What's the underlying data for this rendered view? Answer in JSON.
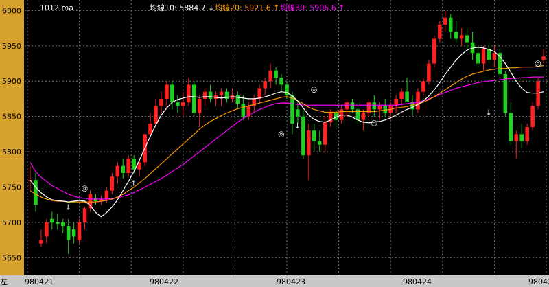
{
  "chart_data": {
    "type": "candlestick",
    "title": "1012.ma",
    "legend": [
      {
        "label": "均線10: 5884.7",
        "arrow": "↓",
        "color": "#ffffff"
      },
      {
        "label": "均線20: 5921.6",
        "arrow": "↑",
        "color": "#ff9900"
      },
      {
        "label": "均線30: 5906.6",
        "arrow": "↑",
        "color": "#ff00ff"
      }
    ],
    "ylim": [
      5625,
      6015
    ],
    "yticks": [
      5650,
      5700,
      5750,
      5800,
      5850,
      5900,
      5950,
      6000
    ],
    "xtick_labels": [
      "980421",
      "980422",
      "980423",
      "980424",
      "98042"
    ],
    "left_axis_fragment": "左",
    "colors": {
      "up": "#ff2020",
      "down": "#20d020",
      "ma10": "#ffffff",
      "ma20": "#ff9900",
      "ma30": "#ff00ff",
      "grid": "#7a7a7a",
      "axis_bg": "#d6a12c"
    },
    "candles": [
      [
        5760,
        5780,
        5745,
        5760
      ],
      [
        5760,
        5770,
        5715,
        5725
      ],
      [
        5670,
        5690,
        5665,
        5675
      ],
      [
        5680,
        5705,
        5670,
        5700
      ],
      [
        5705,
        5715,
        5690,
        5700
      ],
      [
        5700,
        5712,
        5690,
        5698
      ],
      [
        5700,
        5705,
        5685,
        5695
      ],
      [
        5695,
        5705,
        5655,
        5675
      ],
      [
        5690,
        5700,
        5670,
        5680
      ],
      [
        5675,
        5705,
        5670,
        5700
      ],
      [
        5700,
        5722,
        5690,
        5720
      ],
      [
        5720,
        5745,
        5715,
        5740
      ],
      [
        5735,
        5740,
        5725,
        5730
      ],
      [
        5730,
        5738,
        5725,
        5733
      ],
      [
        5733,
        5750,
        5728,
        5745
      ],
      [
        5745,
        5770,
        5740,
        5765
      ],
      [
        5765,
        5785,
        5755,
        5780
      ],
      [
        5780,
        5790,
        5762,
        5770
      ],
      [
        5770,
        5795,
        5765,
        5790
      ],
      [
        5790,
        5795,
        5770,
        5775
      ],
      [
        5775,
        5790,
        5765,
        5785
      ],
      [
        5785,
        5825,
        5780,
        5825
      ],
      [
        5825,
        5855,
        5820,
        5840
      ],
      [
        5840,
        5875,
        5835,
        5865
      ],
      [
        5865,
        5885,
        5855,
        5875
      ],
      [
        5875,
        5900,
        5860,
        5895
      ],
      [
        5895,
        5900,
        5860,
        5870
      ],
      [
        5870,
        5880,
        5855,
        5865
      ],
      [
        5865,
        5885,
        5850,
        5870
      ],
      [
        5870,
        5905,
        5865,
        5895
      ],
      [
        5895,
        5900,
        5850,
        5855
      ],
      [
        5855,
        5880,
        5835,
        5875
      ],
      [
        5875,
        5890,
        5865,
        5885
      ],
      [
        5885,
        5895,
        5870,
        5875
      ],
      [
        5875,
        5885,
        5865,
        5880
      ],
      [
        5880,
        5890,
        5865,
        5885
      ],
      [
        5885,
        5890,
        5870,
        5875
      ],
      [
        5875,
        5890,
        5870,
        5880
      ],
      [
        5880,
        5885,
        5860,
        5868
      ],
      [
        5868,
        5880,
        5845,
        5850
      ],
      [
        5850,
        5870,
        5845,
        5865
      ],
      [
        5865,
        5880,
        5855,
        5875
      ],
      [
        5875,
        5895,
        5870,
        5890
      ],
      [
        5890,
        5905,
        5880,
        5900
      ],
      [
        5900,
        5925,
        5890,
        5915
      ],
      [
        5915,
        5920,
        5895,
        5905
      ],
      [
        5905,
        5910,
        5885,
        5895
      ],
      [
        5895,
        5900,
        5875,
        5880
      ],
      [
        5880,
        5885,
        5825,
        5840
      ],
      [
        5860,
        5870,
        5840,
        5850
      ],
      [
        5850,
        5860,
        5790,
        5795
      ],
      [
        5795,
        5840,
        5760,
        5830
      ],
      [
        5830,
        5840,
        5800,
        5815
      ],
      [
        5815,
        5830,
        5800,
        5810
      ],
      [
        5810,
        5850,
        5800,
        5842
      ],
      [
        5842,
        5860,
        5835,
        5855
      ],
      [
        5855,
        5862,
        5835,
        5845
      ],
      [
        5845,
        5865,
        5840,
        5860
      ],
      [
        5860,
        5875,
        5850,
        5870
      ],
      [
        5870,
        5875,
        5855,
        5860
      ],
      [
        5860,
        5870,
        5840,
        5845
      ],
      [
        5845,
        5860,
        5830,
        5855
      ],
      [
        5855,
        5875,
        5850,
        5870
      ],
      [
        5870,
        5880,
        5850,
        5860
      ],
      [
        5860,
        5870,
        5845,
        5865
      ],
      [
        5865,
        5875,
        5850,
        5855
      ],
      [
        5855,
        5870,
        5845,
        5865
      ],
      [
        5865,
        5880,
        5855,
        5875
      ],
      [
        5875,
        5890,
        5865,
        5885
      ],
      [
        5885,
        5905,
        5870,
        5870
      ],
      [
        5870,
        5880,
        5850,
        5860
      ],
      [
        5860,
        5890,
        5855,
        5885
      ],
      [
        5885,
        5905,
        5880,
        5900
      ],
      [
        5900,
        5930,
        5895,
        5925
      ],
      [
        5925,
        5965,
        5920,
        5960
      ],
      [
        5960,
        5985,
        5955,
        5980
      ],
      [
        5980,
        6000,
        5970,
        5990
      ],
      [
        5990,
        5995,
        5960,
        5970
      ],
      [
        5970,
        5985,
        5955,
        5960
      ],
      [
        5960,
        5975,
        5950,
        5965
      ],
      [
        5965,
        5975,
        5945,
        5955
      ],
      [
        5955,
        5970,
        5930,
        5940
      ],
      [
        5940,
        5950,
        5920,
        5925
      ],
      [
        5925,
        5950,
        5915,
        5945
      ],
      [
        5945,
        5955,
        5925,
        5930
      ],
      [
        5930,
        5950,
        5920,
        5940
      ],
      [
        5940,
        5945,
        5905,
        5910
      ],
      [
        5910,
        5915,
        5850,
        5855
      ],
      [
        5855,
        5870,
        5810,
        5815
      ],
      [
        5815,
        5830,
        5790,
        5825
      ],
      [
        5825,
        5840,
        5805,
        5815
      ],
      [
        5815,
        5840,
        5810,
        5835
      ],
      [
        5835,
        5870,
        5830,
        5865
      ],
      [
        5865,
        5905,
        5860,
        5900
      ],
      [
        5930,
        5945,
        5925,
        5935
      ]
    ],
    "ma10": [
      5760,
      5750,
      5742,
      5736,
      5732,
      5731,
      5730,
      5729,
      5730,
      5731,
      5730,
      5724,
      5714,
      5708,
      5714,
      5722,
      5732,
      5745,
      5758,
      5772,
      5788,
      5805,
      5822,
      5838,
      5852,
      5862,
      5870,
      5874,
      5876,
      5878,
      5878,
      5877,
      5878,
      5878,
      5877,
      5876,
      5877,
      5878,
      5877,
      5876,
      5875,
      5875,
      5876,
      5878,
      5880,
      5883,
      5885,
      5884,
      5879,
      5872,
      5862,
      5852,
      5846,
      5843,
      5842,
      5845,
      5849,
      5852,
      5852,
      5849,
      5845,
      5842,
      5841,
      5842,
      5843,
      5845,
      5848,
      5852,
      5856,
      5860,
      5863,
      5867,
      5872,
      5879,
      5888,
      5898,
      5910,
      5920,
      5930,
      5938,
      5944,
      5947,
      5948,
      5947,
      5945,
      5942,
      5935,
      5925,
      5913,
      5900,
      5890,
      5884,
      5883,
      5883,
      5885
    ],
    "ma20": [
      5745,
      5740,
      5736,
      5733,
      5731,
      5730,
      5730,
      5729,
      5729,
      5729,
      5729,
      5729,
      5729,
      5730,
      5731,
      5733,
      5736,
      5740,
      5745,
      5750,
      5756,
      5762,
      5769,
      5776,
      5783,
      5790,
      5797,
      5804,
      5811,
      5818,
      5825,
      5832,
      5838,
      5843,
      5847,
      5851,
      5855,
      5858,
      5861,
      5863,
      5865,
      5867,
      5869,
      5871,
      5873,
      5875,
      5877,
      5878,
      5876,
      5872,
      5868,
      5863,
      5860,
      5858,
      5856,
      5856,
      5856,
      5857,
      5857,
      5857,
      5857,
      5857,
      5857,
      5857,
      5858,
      5859,
      5860,
      5862,
      5863,
      5864,
      5866,
      5868,
      5870,
      5874,
      5878,
      5883,
      5888,
      5893,
      5898,
      5903,
      5907,
      5910,
      5912,
      5914,
      5916,
      5917,
      5918,
      5918,
      5919,
      5919,
      5920,
      5920,
      5920,
      5921,
      5922
    ],
    "ma30": [
      5785,
      5772,
      5764,
      5758,
      5752,
      5748,
      5744,
      5740,
      5737,
      5735,
      5734,
      5733,
      5733,
      5733,
      5733,
      5734,
      5735,
      5737,
      5739,
      5742,
      5746,
      5750,
      5754,
      5758,
      5762,
      5767,
      5772,
      5777,
      5782,
      5788,
      5794,
      5800,
      5806,
      5812,
      5818,
      5824,
      5830,
      5836,
      5842,
      5847,
      5852,
      5856,
      5860,
      5863,
      5866,
      5868,
      5869,
      5869,
      5868,
      5867,
      5866,
      5866,
      5866,
      5866,
      5866,
      5866,
      5866,
      5866,
      5866,
      5866,
      5866,
      5866,
      5866,
      5866,
      5866,
      5866,
      5866,
      5866,
      5867,
      5868,
      5869,
      5870,
      5872,
      5875,
      5878,
      5881,
      5884,
      5887,
      5890,
      5892,
      5894,
      5896,
      5898,
      5899,
      5900,
      5901,
      5902,
      5903,
      5904,
      5904,
      5905,
      5905,
      5906,
      5906,
      5906
    ],
    "annotations": [
      {
        "index": 10,
        "price": 5745,
        "symbol": "◎",
        "color": "#ffffff"
      },
      {
        "index": 7,
        "price": 5718,
        "symbol": "↓",
        "color": "#ffffff"
      },
      {
        "index": 19,
        "price": 5752,
        "symbol": "↑",
        "color": "#ffffff"
      },
      {
        "index": 46,
        "price": 5822,
        "symbol": "◎",
        "color": "#ffffff"
      },
      {
        "index": 52,
        "price": 5885,
        "symbol": "◎",
        "color": "#ffffff"
      },
      {
        "index": 49,
        "price": 5833,
        "symbol": "↓",
        "color": "#ffffff"
      },
      {
        "index": 63,
        "price": 5838,
        "symbol": "◎",
        "color": "#ffffff"
      },
      {
        "index": 84,
        "price": 5852,
        "symbol": "↓",
        "color": "#ffffff"
      },
      {
        "index": 93,
        "price": 5922,
        "symbol": "◎",
        "color": "#ffffff"
      }
    ]
  }
}
